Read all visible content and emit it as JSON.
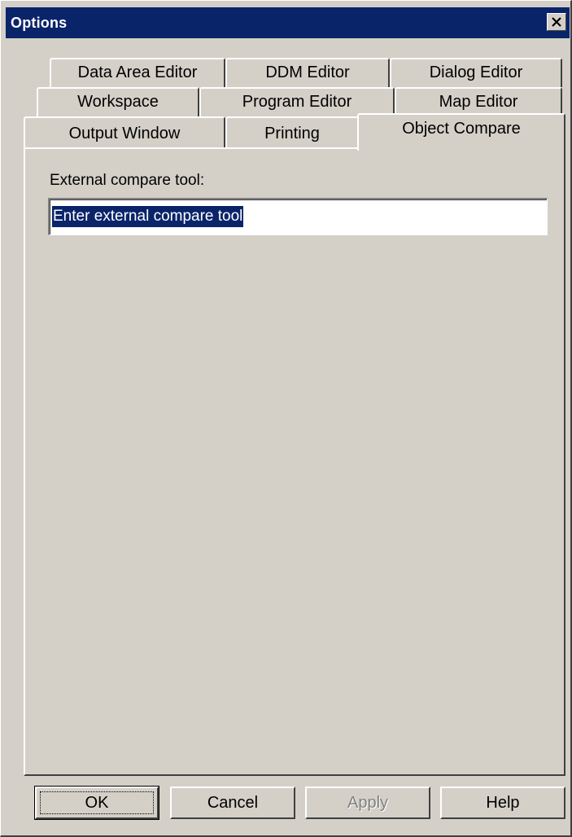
{
  "window": {
    "title": "Options",
    "close_icon": "close-icon"
  },
  "tabs": {
    "row1": [
      "Data Area Editor",
      "DDM Editor",
      "Dialog Editor"
    ],
    "row2": [
      "Workspace",
      "Program Editor",
      "Map Editor"
    ],
    "row3": [
      "Output Window",
      "Printing",
      "Object Compare"
    ],
    "active": "Object Compare"
  },
  "panel": {
    "label": "External compare tool:",
    "input_value": "Enter external compare tool"
  },
  "buttons": {
    "ok": "OK",
    "cancel": "Cancel",
    "apply": "Apply",
    "help": "Help"
  },
  "colors": {
    "titlebar": "#0a246a",
    "face": "#d4d0c8",
    "selection": "#0a246a"
  }
}
